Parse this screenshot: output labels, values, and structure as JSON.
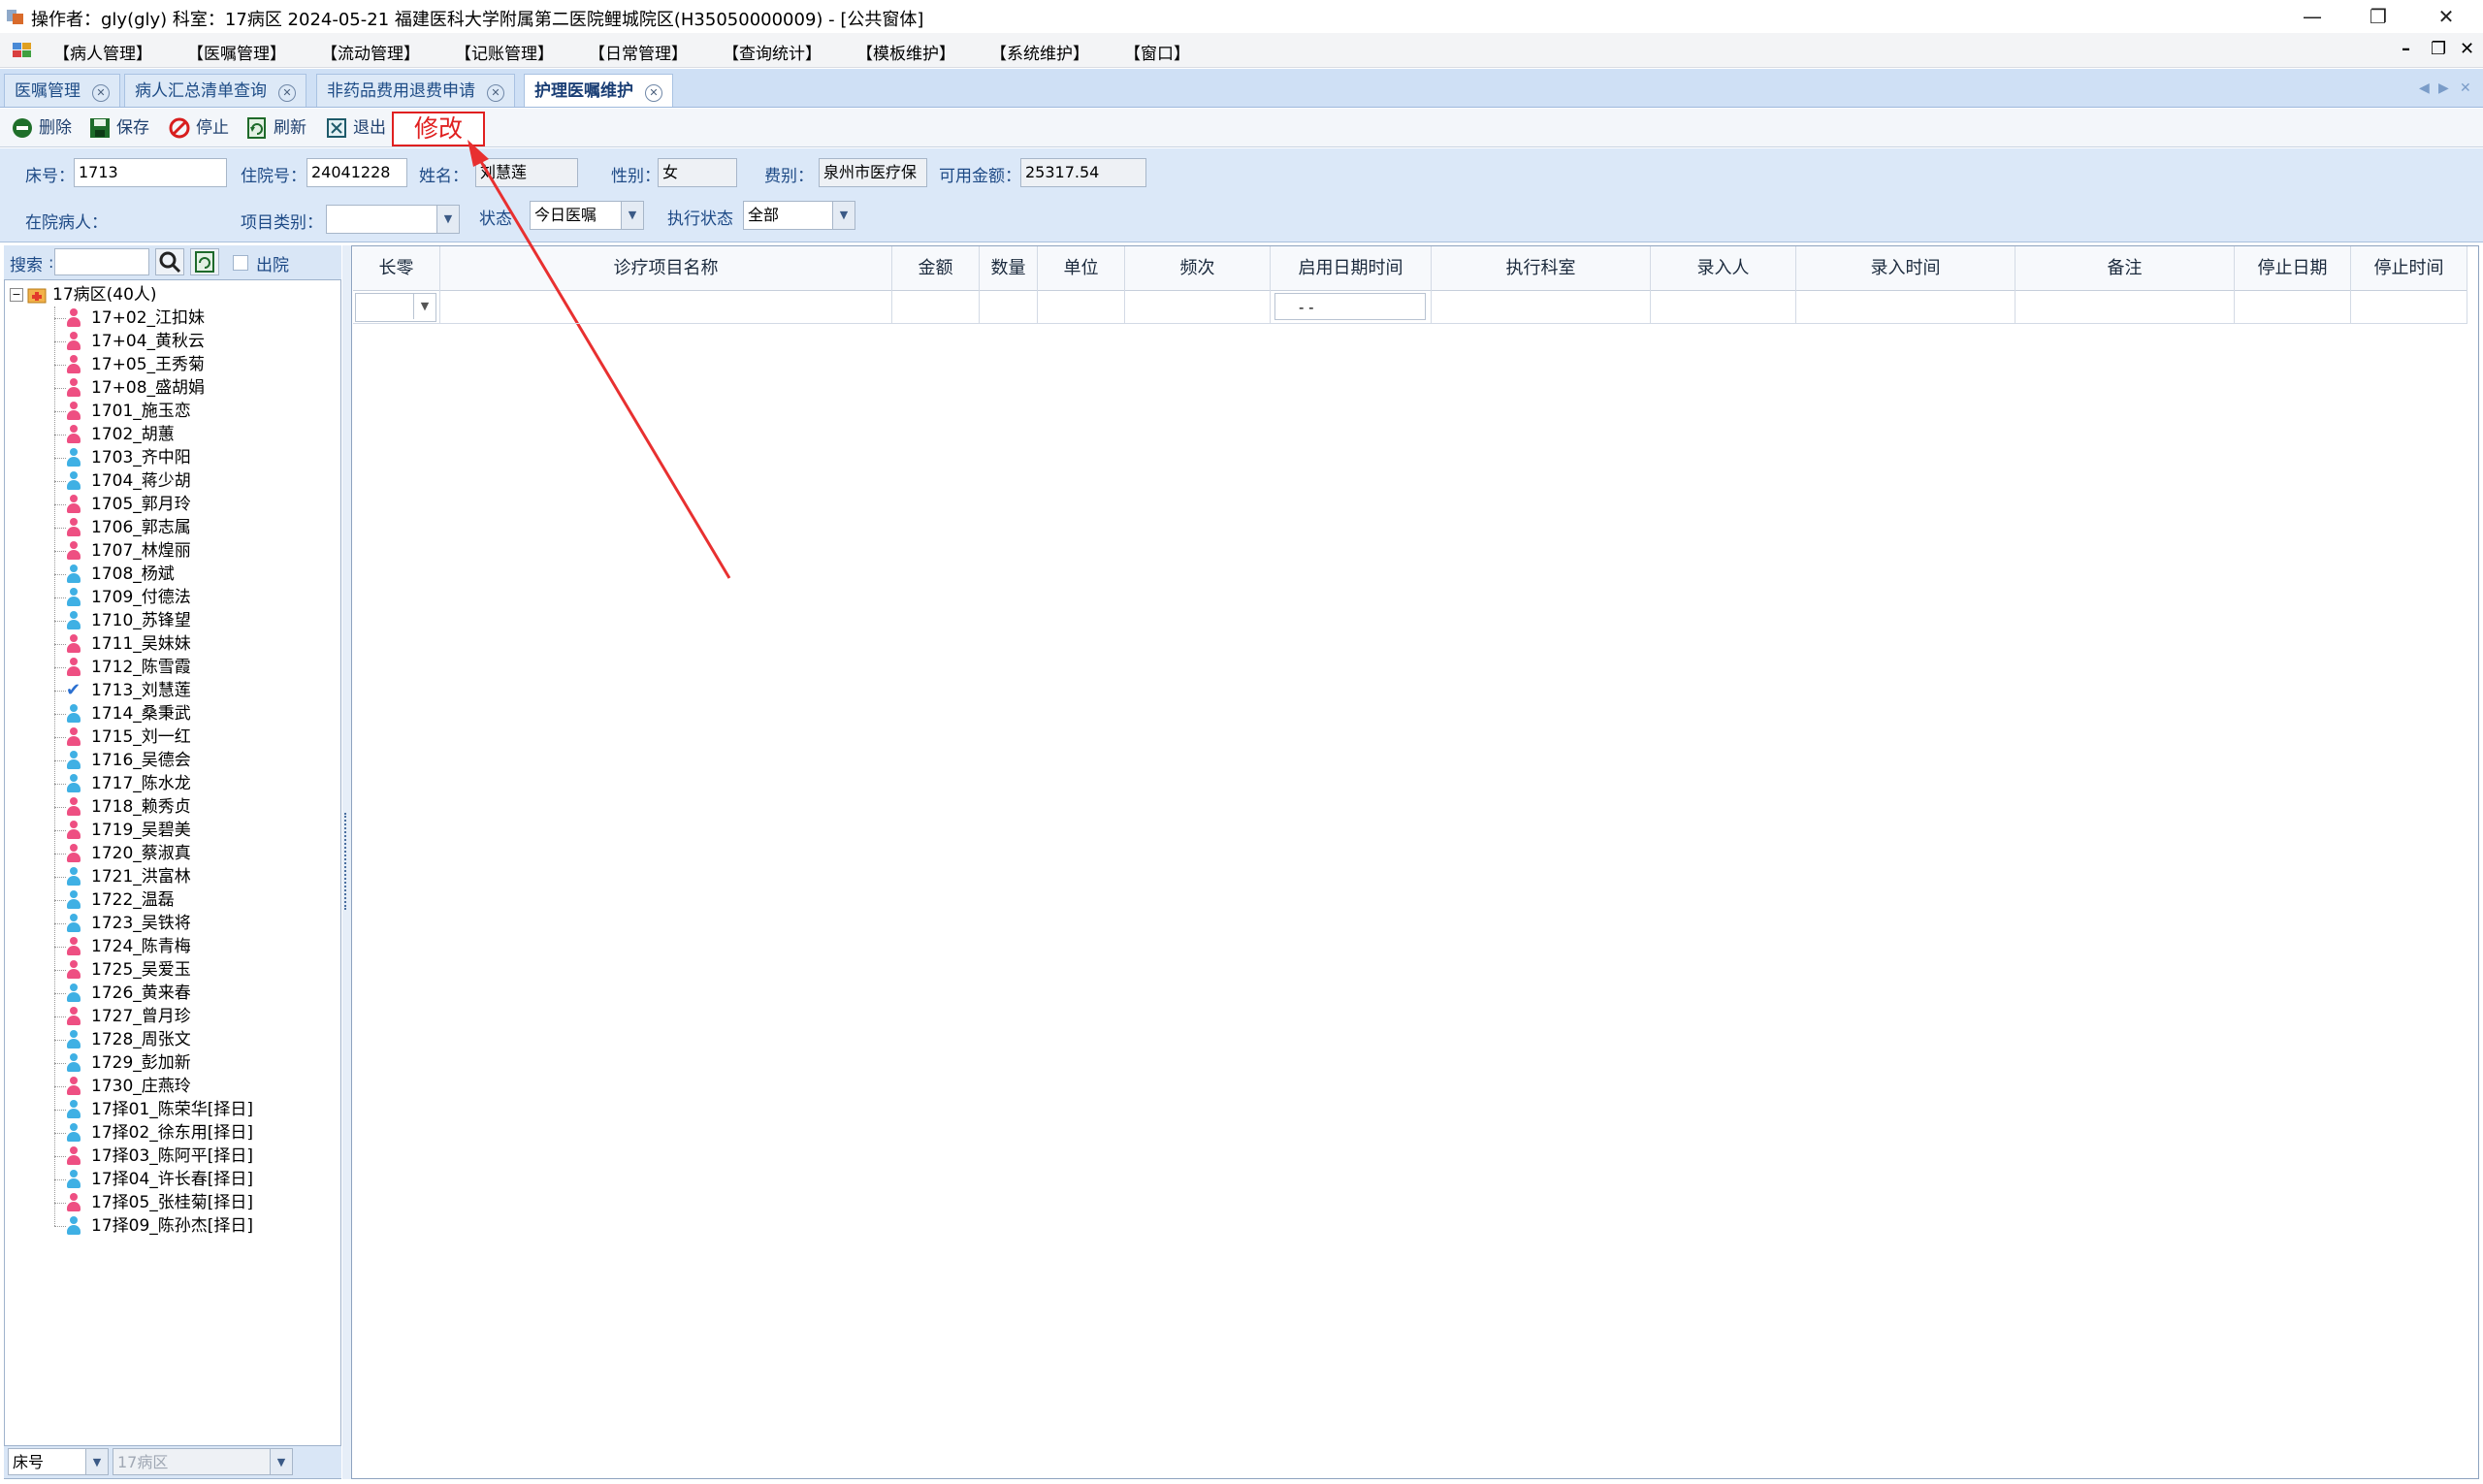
{
  "window": {
    "title": "操作者：gly(gly)  科室：17病区  2024-05-21  福建医科大学附属第二医院鲤城院区(H35050000009) - [公共窗体]",
    "minimize": "—",
    "maximize": "❐",
    "close": "✕"
  },
  "menu": {
    "items": [
      "【病人管理】",
      "【医嘱管理】",
      "【流动管理】",
      "【记账管理】",
      "【日常管理】",
      "【查询统计】",
      "【模板维护】",
      "【系统维护】",
      "【窗口】"
    ],
    "mdi_min": "–",
    "mdi_restore": "❐",
    "mdi_close": "✕"
  },
  "tabs": [
    {
      "label": "医嘱管理",
      "active": false
    },
    {
      "label": "病人汇总清单查询",
      "active": false
    },
    {
      "label": "非药品费用退费申请",
      "active": false
    },
    {
      "label": "护理医嘱维护",
      "active": true
    }
  ],
  "tab_nav": {
    "prev": "◀",
    "next": "▶",
    "close": "✕"
  },
  "toolbar": {
    "delete": "删除",
    "save": "保存",
    "stop": "停止",
    "refresh": "刷新",
    "exit": "退出",
    "annotation": "修改"
  },
  "filters": {
    "bed_label": "床号：",
    "bed_value": "1713",
    "admission_label": "住院号：",
    "admission_value": "24041228",
    "name_label": "姓名：",
    "name_value": "刘慧莲",
    "sex_label": "性别：",
    "sex_value": "女",
    "fee_label": "费别：",
    "fee_value": "泉州市医疗保",
    "balance_label": "可用金额：",
    "balance_value": "25317.54",
    "inpatient_label": "在院病人：",
    "category_label": "项目类别：",
    "category_value": "",
    "status_label": "状态",
    "status_value": "今日医嘱",
    "exec_label": "执行状态",
    "exec_value": "全部"
  },
  "left": {
    "search_label": "搜索",
    "search_value": "",
    "discharged_label": "出院",
    "root": "17病区(40人)",
    "patients": [
      {
        "label": "17+02_江扣妹",
        "sex": "female"
      },
      {
        "label": "17+04_黄秋云",
        "sex": "female"
      },
      {
        "label": "17+05_王秀菊",
        "sex": "female"
      },
      {
        "label": "17+08_盛胡娟",
        "sex": "female"
      },
      {
        "label": "1701_施玉恋",
        "sex": "female"
      },
      {
        "label": "1702_胡蕙",
        "sex": "female"
      },
      {
        "label": "1703_齐中阳",
        "sex": "male"
      },
      {
        "label": "1704_蒋少胡",
        "sex": "male"
      },
      {
        "label": "1705_郭月玲",
        "sex": "female"
      },
      {
        "label": "1706_郭志属",
        "sex": "female"
      },
      {
        "label": "1707_林煌丽",
        "sex": "female"
      },
      {
        "label": "1708_杨斌",
        "sex": "male"
      },
      {
        "label": "1709_付德法",
        "sex": "male"
      },
      {
        "label": "1710_苏锋望",
        "sex": "male"
      },
      {
        "label": "1711_吴妹妹",
        "sex": "female"
      },
      {
        "label": "1712_陈雪霞",
        "sex": "female"
      },
      {
        "label": "1713_刘慧莲",
        "sex": "selected"
      },
      {
        "label": "1714_桑秉武",
        "sex": "male"
      },
      {
        "label": "1715_刘一红",
        "sex": "female"
      },
      {
        "label": "1716_吴德会",
        "sex": "male"
      },
      {
        "label": "1717_陈水龙",
        "sex": "male"
      },
      {
        "label": "1718_赖秀贞",
        "sex": "female"
      },
      {
        "label": "1719_吴碧美",
        "sex": "female"
      },
      {
        "label": "1720_蔡淑真",
        "sex": "female"
      },
      {
        "label": "1721_洪富林",
        "sex": "male"
      },
      {
        "label": "1722_温磊",
        "sex": "male"
      },
      {
        "label": "1723_吴铁将",
        "sex": "male"
      },
      {
        "label": "1724_陈青梅",
        "sex": "female"
      },
      {
        "label": "1725_吴爱玉",
        "sex": "female"
      },
      {
        "label": "1726_黄来春",
        "sex": "male"
      },
      {
        "label": "1727_曾月珍",
        "sex": "female"
      },
      {
        "label": "1728_周张文",
        "sex": "male"
      },
      {
        "label": "1729_彭加新",
        "sex": "male"
      },
      {
        "label": "1730_庄燕玲",
        "sex": "female"
      },
      {
        "label": "17择01_陈荣华[择日]",
        "sex": "male"
      },
      {
        "label": "17择02_徐东用[择日]",
        "sex": "male"
      },
      {
        "label": "17择03_陈阿平[择日]",
        "sex": "female"
      },
      {
        "label": "17择04_许长春[择日]",
        "sex": "male"
      },
      {
        "label": "17择05_张桂菊[择日]",
        "sex": "female"
      },
      {
        "label": "17择09_陈孙杰[择日]",
        "sex": "male"
      }
    ],
    "bottom_sort": "床号",
    "bottom_ward": "17病区"
  },
  "grid": {
    "columns": [
      "长零",
      "诊疗项目名称",
      "金额",
      "数量",
      "单位",
      "频次",
      "启用日期时间",
      "执行科室",
      "录入人",
      "录入时间",
      "备注",
      "停止日期",
      "停止时间"
    ],
    "new_row_date": "-   -"
  },
  "colors": {
    "accent": "#1e4c86",
    "panel_bg": "#dbe8f8",
    "annotation_red": "#e02020",
    "female_icon": "#ee4f82",
    "male_icon": "#3fb0e4"
  }
}
